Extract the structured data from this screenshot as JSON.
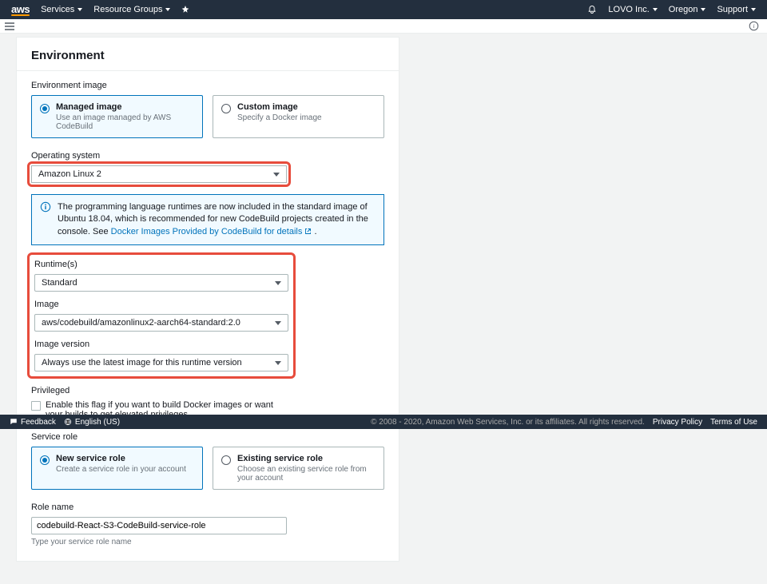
{
  "nav": {
    "logo": "aws",
    "services": "Services",
    "resource_groups": "Resource Groups",
    "account": "LOVO Inc.",
    "region": "Oregon",
    "support": "Support"
  },
  "panel": {
    "title": "Environment"
  },
  "env_image": {
    "label": "Environment image",
    "managed_title": "Managed image",
    "managed_sub": "Use an image managed by AWS CodeBuild",
    "custom_title": "Custom image",
    "custom_sub": "Specify a Docker image"
  },
  "os": {
    "label": "Operating system",
    "value": "Amazon Linux 2"
  },
  "alert": {
    "text_part1": "The programming language runtimes are now included in the standard image of Ubuntu 18.04, which is recommended for new CodeBuild projects created in the console. See ",
    "link": "Docker Images Provided by CodeBuild for details",
    "text_part2": " ."
  },
  "runtime": {
    "label": "Runtime(s)",
    "value": "Standard"
  },
  "image": {
    "label": "Image",
    "value": "aws/codebuild/amazonlinux2-aarch64-standard:2.0"
  },
  "image_version": {
    "label": "Image version",
    "value": "Always use the latest image for this runtime version"
  },
  "privileged": {
    "label": "Privileged",
    "checkbox_label": "Enable this flag if you want to build Docker images or want your builds to get elevated privileges"
  },
  "service_role": {
    "label": "Service role",
    "new_title": "New service role",
    "new_sub": "Create a service role in your account",
    "existing_title": "Existing service role",
    "existing_sub": "Choose an existing service role from your account"
  },
  "role_name": {
    "label": "Role name",
    "value": "codebuild-React-S3-CodeBuild-service-role",
    "hint": "Type your service role name"
  },
  "footer": {
    "feedback": "Feedback",
    "language": "English (US)",
    "copy": "© 2008 - 2020, Amazon Web Services, Inc. or its affiliates. All rights reserved.",
    "privacy": "Privacy Policy",
    "terms": "Terms of Use"
  }
}
